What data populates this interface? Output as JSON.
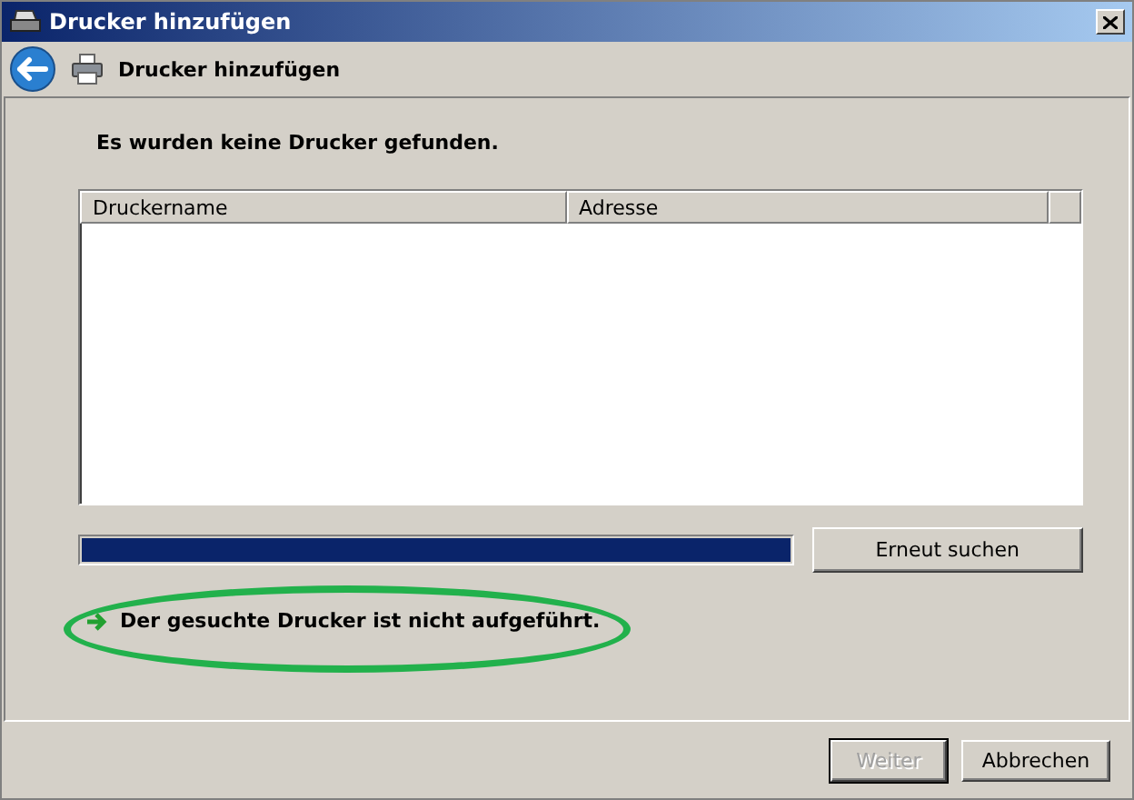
{
  "window": {
    "title": "Drucker hinzufügen"
  },
  "header": {
    "title": "Drucker hinzufügen"
  },
  "message": "Es wurden keine Drucker gefunden.",
  "table": {
    "columns": [
      "Druckername",
      "Adresse"
    ]
  },
  "progress": {
    "level": 1
  },
  "search_again_button": "Erneut suchen",
  "not_listed_link": "Der gesuchte Drucker ist nicht aufgeführt.",
  "annotation": {
    "kind": "ellipse",
    "color": "#22b14c"
  },
  "buttons": [
    {
      "label": "Weiter",
      "disabled": true
    },
    {
      "label": "Abbrechen",
      "disabled": false
    }
  ]
}
